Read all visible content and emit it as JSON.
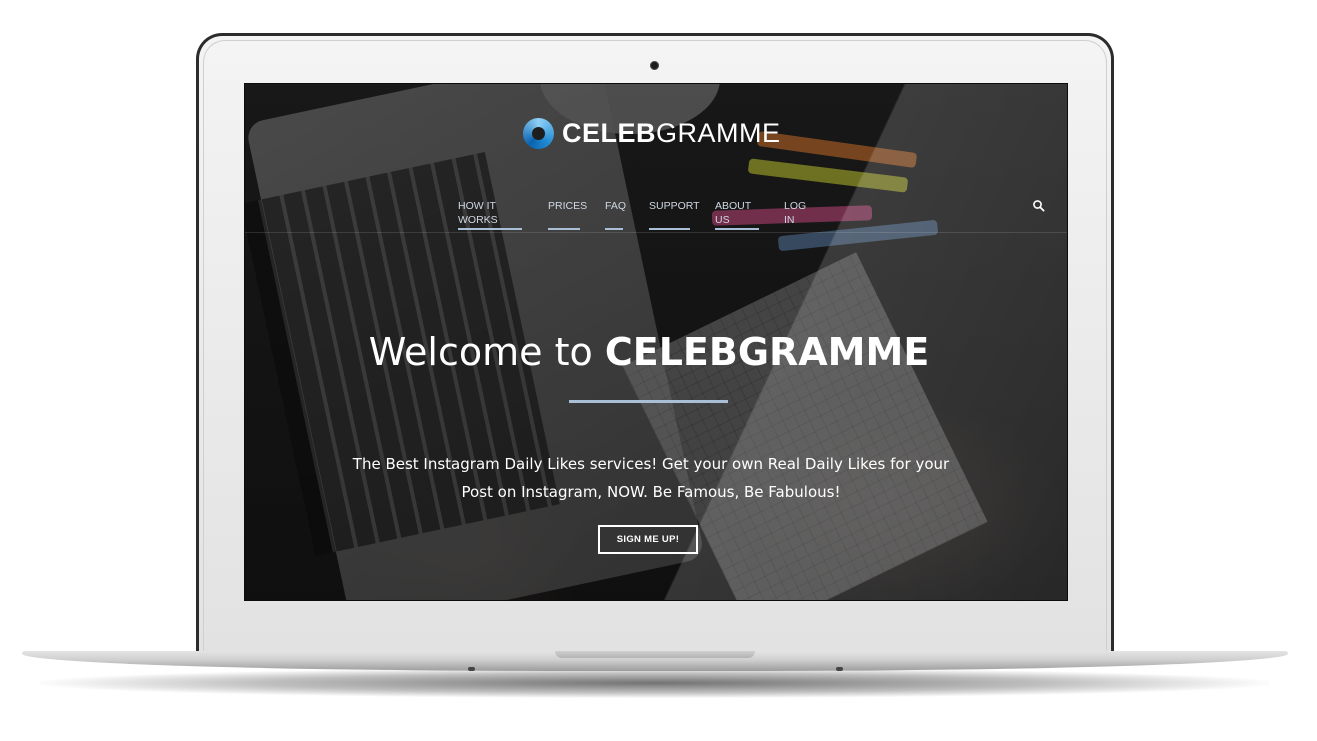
{
  "brand": {
    "name_bold": "CELEB",
    "name_light": "GRAMME",
    "logo_icon": "swirl-logo-icon",
    "accent_color": "#a9bfd6"
  },
  "nav": {
    "items": [
      {
        "label": "HOW IT WORKS"
      },
      {
        "label": "PRICES"
      },
      {
        "label": "FAQ"
      },
      {
        "label": "SUPPORT"
      },
      {
        "label": "ABOUT US"
      },
      {
        "label": "LOG IN"
      }
    ],
    "search_icon": "search-icon"
  },
  "hero": {
    "title_prefix": "Welcome to ",
    "title_brand": "CELEBGRAMME",
    "subtitle": "The Best Instagram Daily Likes services! Get your own Real Daily Likes for your Post on Instagram, NOW. Be Famous, Be Fabulous!",
    "cta_label": "SIGN ME UP!"
  }
}
